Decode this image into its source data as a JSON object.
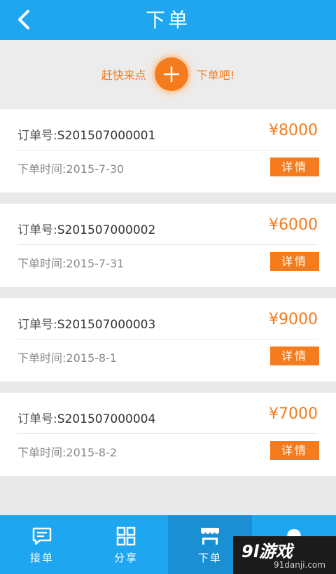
{
  "header": {
    "title": "下单"
  },
  "promo": {
    "left_text": "赶快来点",
    "right_text": "下单吧!"
  },
  "orders": [
    {
      "order_label": "订单号:",
      "order_no": "S201507000001",
      "price": "¥8000",
      "time_label": "下单时间:",
      "time": "2015-7-30",
      "detail_label": "详情"
    },
    {
      "order_label": "订单号:",
      "order_no": "S201507000002",
      "price": "¥6000",
      "time_label": "下单时间:",
      "time": "2015-7-31",
      "detail_label": "详情"
    },
    {
      "order_label": "订单号:",
      "order_no": "S201507000003",
      "price": "¥9000",
      "time_label": "下单时间:",
      "time": "2015-8-1",
      "detail_label": "详情"
    },
    {
      "order_label": "订单号:",
      "order_no": "S201507000004",
      "price": "¥7000",
      "time_label": "下单时间:",
      "time": "2015-8-2",
      "detail_label": "详情"
    }
  ],
  "tabbar": {
    "items": [
      {
        "label": "接单",
        "icon": "message-icon"
      },
      {
        "label": "分享",
        "icon": "grid-icon"
      },
      {
        "label": "下单",
        "icon": "shop-icon",
        "active": true
      },
      {
        "label": "",
        "icon": "helmet-icon"
      }
    ]
  },
  "watermark": {
    "logo": "9l游戏",
    "url": "91danji.com"
  },
  "colors": {
    "primary": "#1fa6f0",
    "accent": "#f57c1e",
    "background": "#e9e9e9"
  }
}
